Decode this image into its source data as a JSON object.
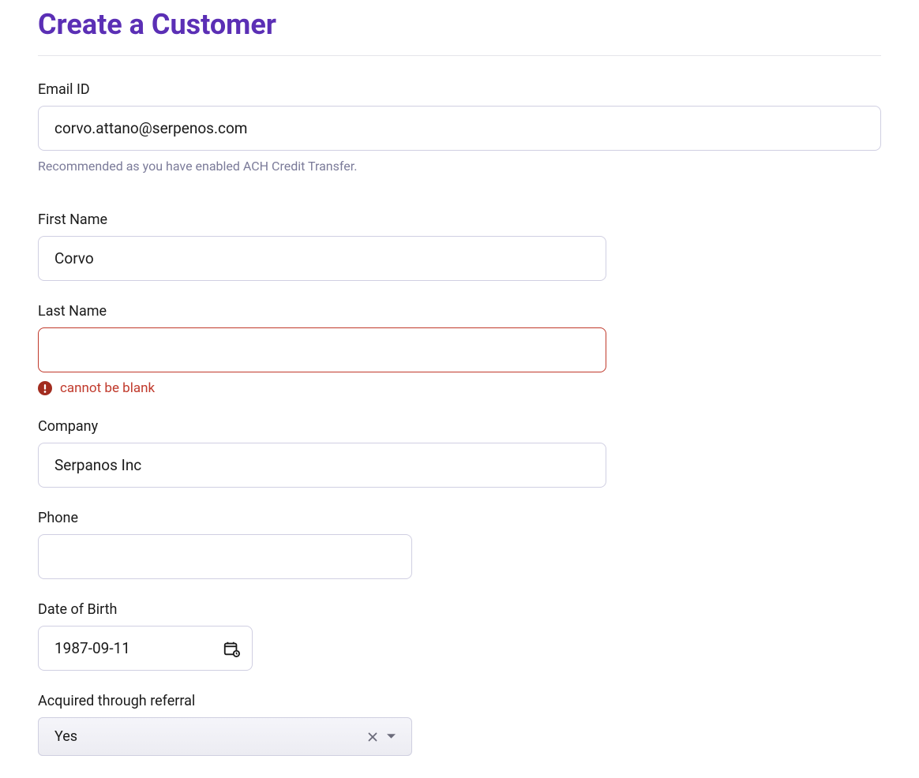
{
  "page": {
    "title": "Create a Customer"
  },
  "fields": {
    "email": {
      "label": "Email ID",
      "value": "corvo.attano@serpenos.com",
      "help": "Recommended as you have enabled ACH Credit Transfer."
    },
    "first_name": {
      "label": "First Name",
      "value": "Corvo"
    },
    "last_name": {
      "label": "Last Name",
      "value": "",
      "error": "cannot be blank"
    },
    "company": {
      "label": "Company",
      "value": "Serpanos Inc"
    },
    "phone": {
      "label": "Phone",
      "value": ""
    },
    "dob": {
      "label": "Date of Birth",
      "value": "1987-09-11"
    },
    "referral": {
      "label": "Acquired through referral",
      "value": "Yes"
    }
  }
}
